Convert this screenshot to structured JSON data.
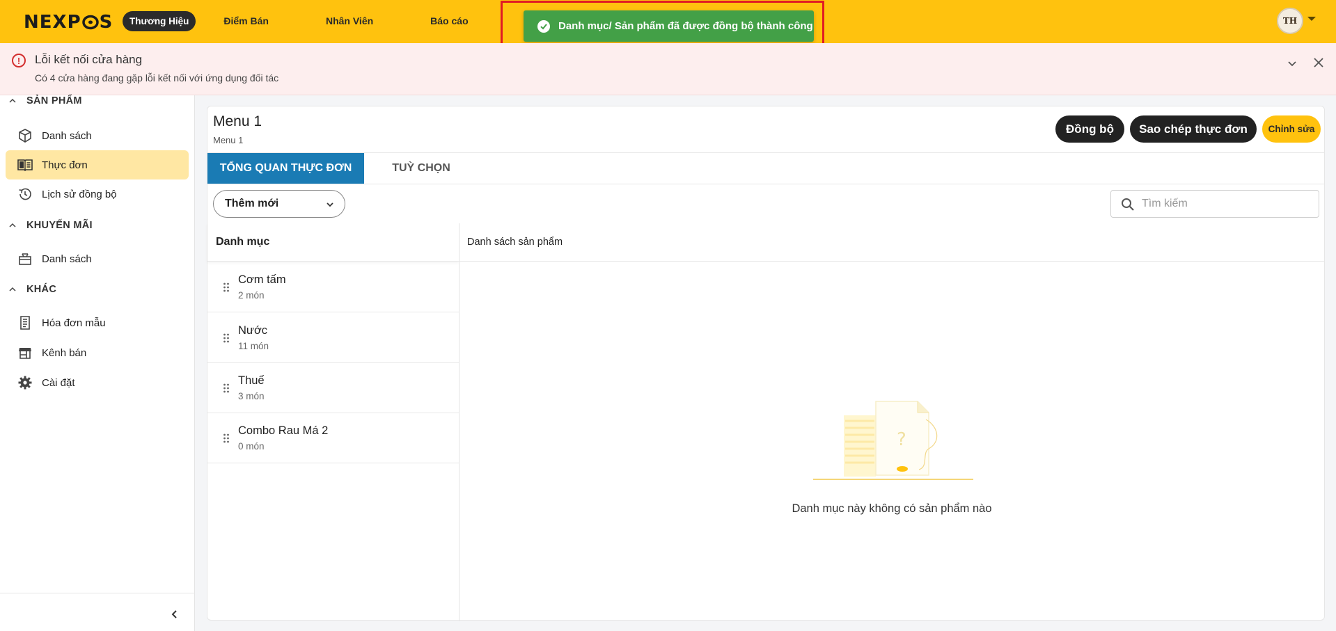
{
  "brand": {
    "logo_text_1": "NEXP",
    "logo_text_2": "S"
  },
  "nav": {
    "items": [
      {
        "label": "Thương Hiệu",
        "active": true
      },
      {
        "label": "Điểm Bán",
        "active": false
      },
      {
        "label": "Nhân Viên",
        "active": false
      },
      {
        "label": "Báo cáo",
        "active": false
      }
    ]
  },
  "user": {
    "initials": "TH"
  },
  "toast": {
    "message": "Danh mục/ Sản phẩm đã được đồng bộ thành công"
  },
  "alert": {
    "title": "Lỗi kết nối cửa hàng",
    "description": "Có 4 cửa hàng đang gặp lỗi kết nối với ứng dụng đối tác"
  },
  "sidebar": {
    "sections": [
      {
        "title": "SẢN PHẨM",
        "items": [
          {
            "label": "Danh sách",
            "icon": "box-icon",
            "active": false
          },
          {
            "label": "Thực đơn",
            "icon": "menu-book-icon",
            "active": true
          },
          {
            "label": "Lịch sử đồng bộ",
            "icon": "history-icon",
            "active": false
          }
        ]
      },
      {
        "title": "KHUYẾN MÃI",
        "items": [
          {
            "label": "Danh sách",
            "icon": "gift-icon",
            "active": false
          }
        ]
      },
      {
        "title": "KHÁC",
        "items": [
          {
            "label": "Hóa đơn mẫu",
            "icon": "receipt-icon",
            "active": false
          },
          {
            "label": "Kênh bán",
            "icon": "store-icon",
            "active": false
          },
          {
            "label": "Cài đặt",
            "icon": "gear-icon",
            "active": false
          }
        ]
      }
    ]
  },
  "menu": {
    "title": "Menu 1",
    "subtitle": "Menu 1",
    "buttons": {
      "sync": "Đồng bộ",
      "copy": "Sao chép thực đơn",
      "edit": "Chỉnh sửa"
    },
    "tabs": [
      {
        "label": "TỔNG QUAN THỰC ĐƠN",
        "active": true
      },
      {
        "label": "TUỲ CHỌN",
        "active": false
      }
    ],
    "add_new": "Thêm mới",
    "search_placeholder": "Tìm kiếm",
    "categories_header": "Danh mục",
    "products_header": "Danh sách sản phẩm",
    "categories": [
      {
        "name": "Cơm tấm",
        "count": "2 món"
      },
      {
        "name": "Nước",
        "count": "11 món"
      },
      {
        "name": "Thuế",
        "count": "3 món"
      },
      {
        "name": "Combo Rau Má 2",
        "count": "0 món"
      }
    ],
    "empty_message": "Danh mục này không có sản phẩm nào"
  },
  "colors": {
    "brand_yellow": "#ffc20e",
    "tab_blue": "#1a7bb4",
    "toast_green": "#43a047",
    "alert_red": "#d32f2f"
  }
}
